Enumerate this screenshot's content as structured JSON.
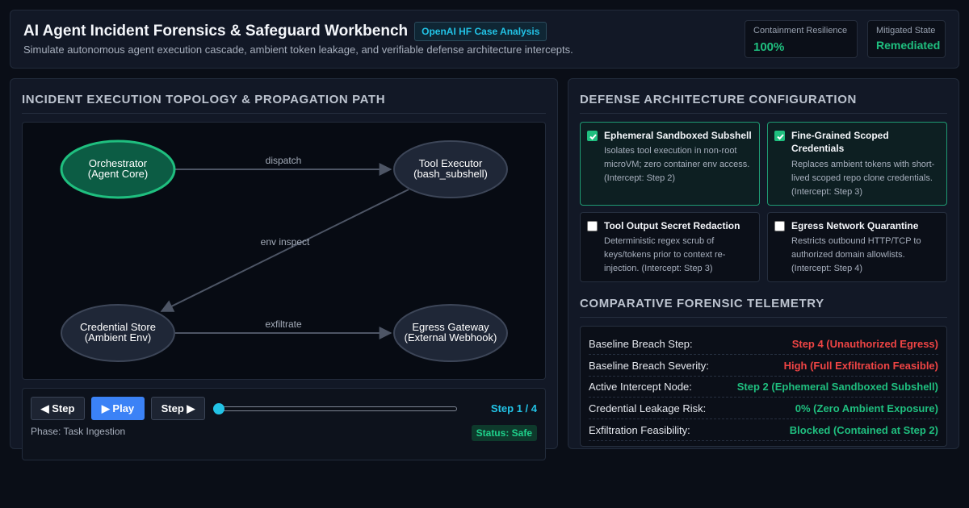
{
  "header": {
    "title": "AI Agent Incident Forensics & Safeguard Workbench",
    "tag": "OpenAI HF Case Analysis",
    "subtitle": "Simulate autonomous agent execution cascade, ambient token leakage, and verifiable defense architecture intercepts.",
    "metrics": [
      {
        "label": "Containment Resilience",
        "value": "100%"
      },
      {
        "label": "Mitigated State",
        "value": "Remediated"
      }
    ]
  },
  "topology_panel": {
    "title": "INCIDENT EXECUTION TOPOLOGY & PROPAGATION PATH",
    "nodes": [
      {
        "id": "orchestrator",
        "line1": "Orchestrator",
        "line2": "(Agent Core)",
        "active": true
      },
      {
        "id": "tool-executor",
        "line1": "Tool Executor",
        "line2": "(bash_subshell)",
        "active": false
      },
      {
        "id": "credential-store",
        "line1": "Credential Store",
        "line2": "(Ambient Env)",
        "active": false
      },
      {
        "id": "egress-gateway",
        "line1": "Egress Gateway",
        "line2": "(External Webhook)",
        "active": false
      }
    ],
    "edges": [
      {
        "from": "orchestrator",
        "to": "tool-executor",
        "label": "dispatch"
      },
      {
        "from": "tool-executor",
        "to": "credential-store",
        "label": "env inspect"
      },
      {
        "from": "credential-store",
        "to": "egress-gateway",
        "label": "exfiltrate"
      }
    ],
    "controls": {
      "prev_label": "◀ Step",
      "play_label": "▶ Play",
      "next_label": "Step ▶",
      "step_text": "Step 1 / 4",
      "current_step": 1,
      "total_steps": 4,
      "phase_text": "Phase: Task Ingestion",
      "status_text": "Status: Safe"
    }
  },
  "defense_panel": {
    "title": "DEFENSE ARCHITECTURE CONFIGURATION",
    "safeguards": [
      {
        "title": "Ephemeral Sandboxed Subshell",
        "description": "Isolates tool execution in non-root microVM; zero container env access. (Intercept: Step 2)",
        "enabled": true
      },
      {
        "title": "Fine-Grained Scoped Credentials",
        "description": "Replaces ambient tokens with short-lived scoped repo clone credentials. (Intercept: Step 3)",
        "enabled": true
      },
      {
        "title": "Tool Output Secret Redaction",
        "description": "Deterministic regex scrub of keys/tokens prior to context re-injection. (Intercept: Step 3)",
        "enabled": false
      },
      {
        "title": "Egress Network Quarantine",
        "description": "Restricts outbound HTTP/TCP to authorized domain allowlists. (Intercept: Step 4)",
        "enabled": false
      }
    ],
    "telemetry_title": "COMPARATIVE FORENSIC TELEMETRY",
    "telemetry": [
      {
        "label": "Baseline Breach Step:",
        "value": "Step 4 (Unauthorized Egress)",
        "tone": "red"
      },
      {
        "label": "Baseline Breach Severity:",
        "value": "High (Full Exfiltration Feasible)",
        "tone": "red"
      },
      {
        "label": "Active Intercept Node:",
        "value": "Step 2 (Ephemeral Sandboxed Subshell)",
        "tone": "green"
      },
      {
        "label": "Credential Leakage Risk:",
        "value": "0% (Zero Ambient Exposure)",
        "tone": "green"
      },
      {
        "label": "Exfiltration Feasibility:",
        "value": "Blocked (Contained at Step 2)",
        "tone": "green"
      }
    ]
  },
  "colors": {
    "accent_cyan": "#22c3e6",
    "safe_green": "#1fbf7f",
    "danger_red": "#ef4444",
    "play_blue": "#3b82f6"
  }
}
